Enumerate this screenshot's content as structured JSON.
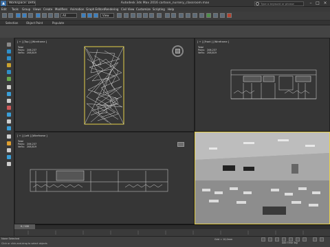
{
  "titlebar": {
    "workspace": "Workspace: Default",
    "title": "Autodesk 3ds Max 2016    cartoon_nursery_classroom.max",
    "search_placeholder": "Type a keyword or phrase"
  },
  "menu": [
    "Edit",
    "Tools",
    "Group",
    "Views",
    "Create",
    "Modifiers",
    "Animation",
    "Graph Editors",
    "Rendering",
    "Civil View",
    "Customize",
    "Scripting",
    "Help"
  ],
  "toolbar": {
    "filter": "All",
    "view": "View"
  },
  "ribbon": [
    "Selection",
    "Object Paint",
    "Populate"
  ],
  "viewports": {
    "top": {
      "label": "[ + ] [Top ] [Wireframe ]",
      "stats": "Total\nPolys:   206,237\nVerts:   208,819"
    },
    "front": {
      "label": "[ + ] [Front ] [Wireframe ]",
      "stats": "Total\nPolys:   206,237\nVerts:   208,819"
    },
    "left": {
      "label": "[ + ] [Left ] [Wireframe ]",
      "stats": "Total\nPolys:   206,237\nVerts:   208,819"
    }
  },
  "timeline": {
    "slider": "0 / 100"
  },
  "status": {
    "left": "None Selected",
    "bottom": "Click or click-and-drag to select objects",
    "grid": "Grid = 10,0mm",
    "timetag": "Add Time Tag"
  },
  "colors": {
    "accent": "#e8d24a",
    "selection": "#e6d34a"
  }
}
